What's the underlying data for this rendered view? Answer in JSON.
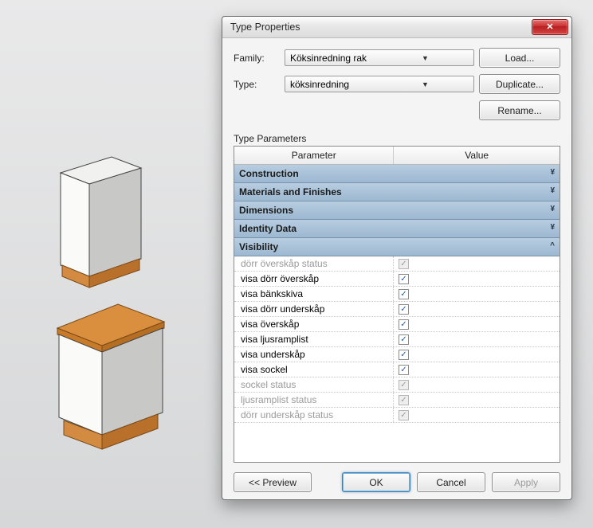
{
  "window": {
    "title": "Type Properties",
    "close_label": "✕"
  },
  "form": {
    "family_label": "Family:",
    "family_value": "Köksinredning rak",
    "type_label": "Type:",
    "type_value": "köksinredning",
    "load_label": "Load...",
    "duplicate_label": "Duplicate...",
    "rename_label": "Rename..."
  },
  "params_section_label": "Type Parameters",
  "grid_headers": {
    "parameter": "Parameter",
    "value": "Value"
  },
  "groups": {
    "construction": "Construction",
    "materials": "Materials and Finishes",
    "dimensions": "Dimensions",
    "identity": "Identity Data",
    "visibility": "Visibility"
  },
  "visibility_params": [
    {
      "name": "dörr överskåp status",
      "checked": true,
      "enabled": false
    },
    {
      "name": "visa dörr överskåp",
      "checked": true,
      "enabled": true
    },
    {
      "name": "visa bänkskiva",
      "checked": true,
      "enabled": true
    },
    {
      "name": "visa dörr underskåp",
      "checked": true,
      "enabled": true
    },
    {
      "name": "visa överskåp",
      "checked": true,
      "enabled": true
    },
    {
      "name": "visa ljusramplist",
      "checked": true,
      "enabled": true
    },
    {
      "name": "visa underskåp",
      "checked": true,
      "enabled": true
    },
    {
      "name": "visa sockel",
      "checked": true,
      "enabled": true
    },
    {
      "name": "sockel status",
      "checked": true,
      "enabled": false
    },
    {
      "name": "ljusramplist status",
      "checked": true,
      "enabled": false
    },
    {
      "name": "dörr underskåp status",
      "checked": true,
      "enabled": false
    }
  ],
  "footer": {
    "preview": "<< Preview",
    "ok": "OK",
    "cancel": "Cancel",
    "apply": "Apply"
  }
}
